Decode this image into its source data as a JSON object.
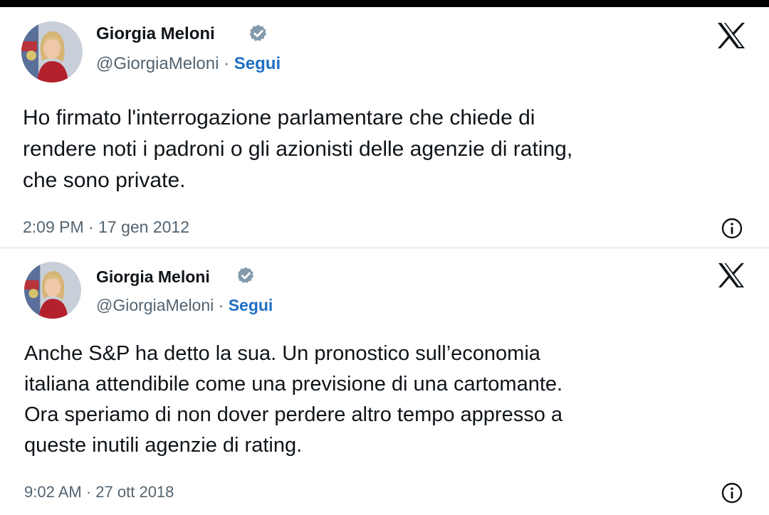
{
  "tweets": [
    {
      "author_name": "Giorgia Meloni",
      "handle": "@GiorgiaMeloni",
      "separator": "·",
      "follow_label": "Segui",
      "text": "Ho firmato l'interrogazione parlamentare che chiede di\nrendere noti i padroni o gli azionisti delle agenzie di rating,\nche sono private.",
      "time": "2:09 PM",
      "date": "17 gen 2012",
      "icons": [
        "avatar",
        "verified-badge-icon",
        "x-logo-icon",
        "info-icon"
      ]
    },
    {
      "author_name": "Giorgia Meloni",
      "handle": "@GiorgiaMeloni",
      "separator": "·",
      "follow_label": "Segui",
      "text": "Anche S&P ha detto la sua. Un pronostico sull’economia\nitaliana attendibile come una previsione di una cartomante.\nOra speriamo di non dover perdere altro tempo appresso a\nqueste inutili agenzie di rating.",
      "time": "9:02 AM",
      "date": "27 ott 2018",
      "icons": [
        "avatar",
        "verified-badge-icon",
        "x-logo-icon",
        "info-icon"
      ]
    }
  ],
  "colors": {
    "text": "#0f1419",
    "secondary": "#536471",
    "follow": "#1d6fc4",
    "verified_badge": "#829aab"
  }
}
